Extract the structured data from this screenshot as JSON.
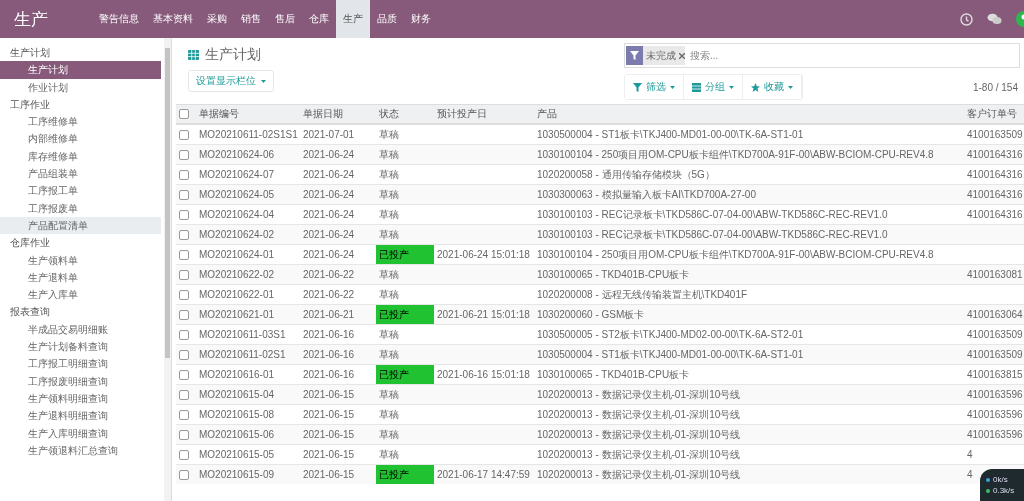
{
  "app": {
    "title": "生产"
  },
  "navbar": {
    "menus": [
      {
        "label": "警告信息",
        "selected": false
      },
      {
        "label": "基本资料",
        "selected": false
      },
      {
        "label": "采购",
        "selected": false
      },
      {
        "label": "销售",
        "selected": false
      },
      {
        "label": "售后",
        "selected": false
      },
      {
        "label": "仓库",
        "selected": false
      },
      {
        "label": "生产",
        "selected": true
      },
      {
        "label": "品质",
        "selected": false
      },
      {
        "label": "财务",
        "selected": false
      }
    ]
  },
  "sidebar": {
    "groups": [
      {
        "label": "生产计划",
        "children": [
          {
            "label": "生产计划",
            "selected": true,
            "hovered": false
          },
          {
            "label": "作业计划",
            "selected": false,
            "hovered": false
          }
        ]
      },
      {
        "label": "工序作业",
        "children": [
          {
            "label": "工序维修单",
            "selected": false,
            "hovered": false
          },
          {
            "label": "内部维修单",
            "selected": false,
            "hovered": false
          },
          {
            "label": "库存维修单",
            "selected": false,
            "hovered": false
          },
          {
            "label": "产品组装单",
            "selected": false,
            "hovered": false
          },
          {
            "label": "工序报工单",
            "selected": false,
            "hovered": false
          },
          {
            "label": "工序报废单",
            "selected": false,
            "hovered": false
          },
          {
            "label": "产品配置清单",
            "selected": false,
            "hovered": true
          }
        ]
      },
      {
        "label": "仓库作业",
        "children": [
          {
            "label": "生产领料单",
            "selected": false,
            "hovered": false
          },
          {
            "label": "生产退料单",
            "selected": false,
            "hovered": false
          },
          {
            "label": "生产入库单",
            "selected": false,
            "hovered": false
          }
        ]
      },
      {
        "label": "报表查询",
        "children": [
          {
            "label": "半成品交易明细账",
            "selected": false,
            "hovered": false
          },
          {
            "label": "生产计划备料查询",
            "selected": false,
            "hovered": false
          },
          {
            "label": "工序报工明细查询",
            "selected": false,
            "hovered": false
          },
          {
            "label": "工序报废明细查询",
            "selected": false,
            "hovered": false
          },
          {
            "label": "生产领料明细查询",
            "selected": false,
            "hovered": false
          },
          {
            "label": "生产退料明细查询",
            "selected": false,
            "hovered": false
          },
          {
            "label": "生产入库明细查询",
            "selected": false,
            "hovered": false
          },
          {
            "label": "生产领退料汇总查询",
            "selected": false,
            "hovered": false
          }
        ]
      }
    ]
  },
  "control_panel": {
    "title": "生产计划",
    "columns_button": "设置显示栏位",
    "search": {
      "facets": [
        {
          "label": "未完成"
        }
      ],
      "placeholder": "搜索..."
    },
    "buttons": [
      {
        "label": "筛选",
        "kind": "filter"
      },
      {
        "label": "分组",
        "kind": "group"
      },
      {
        "label": "收藏",
        "kind": "favorite"
      }
    ],
    "pager": "1-80 / 154"
  },
  "table": {
    "header_checked": false,
    "columns": [
      "单据编号",
      "单据日期",
      "状态",
      "预计投产日",
      "产品",
      "客户订单号"
    ],
    "rows": [
      {
        "checked": false,
        "number": "MO20210611-02S1S1",
        "date": "2021-07-01",
        "status": {
          "label": "草稿",
          "kind": "draft"
        },
        "eta": "",
        "product": "1030500004 - ST1板卡\\TKJ400-MD01-00-00\\TK-6A-ST1-01",
        "customer_order": "4100163509"
      },
      {
        "checked": false,
        "number": "MO20210624-06",
        "date": "2021-06-24",
        "status": {
          "label": "草稿",
          "kind": "draft"
        },
        "eta": "",
        "product": "1030100104 - 250项目用OM-CPU板卡组件\\TKD700A-91F-00\\ABW-BCIOM-CPU-REV4.8",
        "customer_order": "4100164316"
      },
      {
        "checked": false,
        "number": "MO20210624-07",
        "date": "2021-06-24",
        "status": {
          "label": "草稿",
          "kind": "draft"
        },
        "eta": "",
        "product": "1020200058 - 通用传输存储模块（5G）",
        "customer_order": "4100164316"
      },
      {
        "checked": false,
        "number": "MO20210624-05",
        "date": "2021-06-24",
        "status": {
          "label": "草稿",
          "kind": "draft"
        },
        "eta": "",
        "product": "1030300063 - 模拟量输入板卡AI\\TKD700A-27-00",
        "customer_order": "4100164316"
      },
      {
        "checked": false,
        "number": "MO20210624-04",
        "date": "2021-06-24",
        "status": {
          "label": "草稿",
          "kind": "draft"
        },
        "eta": "",
        "product": "1030100103 - REC记录板卡\\TKD586C-07-04-00\\ABW-TKD586C-REC-REV1.0",
        "customer_order": "4100164316"
      },
      {
        "checked": false,
        "number": "MO20210624-02",
        "date": "2021-06-24",
        "status": {
          "label": "草稿",
          "kind": "draft"
        },
        "eta": "",
        "product": "1030100103 - REC记录板卡\\TKD586C-07-04-00\\ABW-TKD586C-REC-REV1.0",
        "customer_order": ""
      },
      {
        "checked": false,
        "number": "MO20210624-01",
        "date": "2021-06-24",
        "status": {
          "label": "已投产",
          "kind": "in_production"
        },
        "eta": "2021-06-24 15:01:18",
        "product": "1030100104 - 250项目用OM-CPU板卡组件\\TKD700A-91F-00\\ABW-BCIOM-CPU-REV4.8",
        "customer_order": ""
      },
      {
        "checked": false,
        "number": "MO20210622-02",
        "date": "2021-06-22",
        "status": {
          "label": "草稿",
          "kind": "draft"
        },
        "eta": "",
        "product": "1030100065 - TKD401B-CPU板卡",
        "customer_order": "4100163081"
      },
      {
        "checked": false,
        "number": "MO20210622-01",
        "date": "2021-06-22",
        "status": {
          "label": "草稿",
          "kind": "draft"
        },
        "eta": "",
        "product": "1020200008 - 远程无线传输装置主机\\TKD401F",
        "customer_order": ""
      },
      {
        "checked": false,
        "number": "MO20210621-01",
        "date": "2021-06-21",
        "status": {
          "label": "已投产",
          "kind": "in_production"
        },
        "eta": "2021-06-21 15:01:18",
        "product": "1030200060 - GSM板卡",
        "customer_order": "4100163064"
      },
      {
        "checked": false,
        "number": "MO20210611-03S1",
        "date": "2021-06-16",
        "status": {
          "label": "草稿",
          "kind": "draft"
        },
        "eta": "",
        "product": "1030500005 - ST2板卡\\TKJ400-MD02-00-00\\TK-6A-ST2-01",
        "customer_order": "4100163509"
      },
      {
        "checked": false,
        "number": "MO20210611-02S1",
        "date": "2021-06-16",
        "status": {
          "label": "草稿",
          "kind": "draft"
        },
        "eta": "",
        "product": "1030500004 - ST1板卡\\TKJ400-MD01-00-00\\TK-6A-ST1-01",
        "customer_order": "4100163509"
      },
      {
        "checked": false,
        "number": "MO20210616-01",
        "date": "2021-06-16",
        "status": {
          "label": "已投产",
          "kind": "in_production"
        },
        "eta": "2021-06-16 15:01:18",
        "product": "1030100065 - TKD401B-CPU板卡",
        "customer_order": "4100163815"
      },
      {
        "checked": false,
        "number": "MO20210615-04",
        "date": "2021-06-15",
        "status": {
          "label": "草稿",
          "kind": "draft"
        },
        "eta": "",
        "product": "1020200013 - 数据记录仪主机-01-深圳10号线",
        "customer_order": "4100163596"
      },
      {
        "checked": false,
        "number": "MO20210615-08",
        "date": "2021-06-15",
        "status": {
          "label": "草稿",
          "kind": "draft"
        },
        "eta": "",
        "product": "1020200013 - 数据记录仪主机-01-深圳10号线",
        "customer_order": "4100163596"
      },
      {
        "checked": false,
        "number": "MO20210615-06",
        "date": "2021-06-15",
        "status": {
          "label": "草稿",
          "kind": "draft"
        },
        "eta": "",
        "product": "1020200013 - 数据记录仪主机-01-深圳10号线",
        "customer_order": "4100163596"
      },
      {
        "checked": false,
        "number": "MO20210615-05",
        "date": "2021-06-15",
        "status": {
          "label": "草稿",
          "kind": "draft"
        },
        "eta": "",
        "product": "1020200013 - 数据记录仪主机-01-深圳10号线",
        "customer_order": "4"
      },
      {
        "checked": false,
        "number": "MO20210615-09",
        "date": "2021-06-15",
        "status": {
          "label": "已投产",
          "kind": "in_production"
        },
        "eta": "2021-06-17 14:47:59",
        "product": "1020200013 - 数据记录仪主机-01-深圳10号线",
        "customer_order": "4"
      }
    ]
  },
  "net_widget": {
    "download": "0k/s",
    "upload": "0.3k/s"
  }
}
